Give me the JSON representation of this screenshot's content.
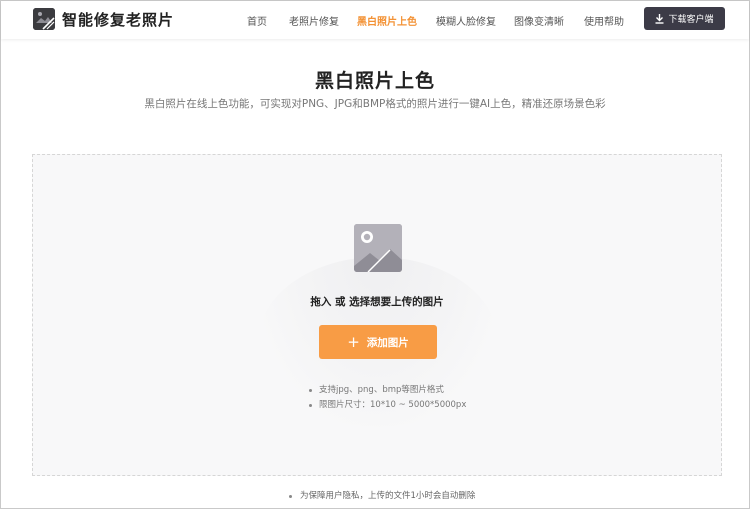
{
  "header": {
    "title": "智能修复老照片",
    "nav": [
      {
        "label": "首页",
        "active": false
      },
      {
        "label": "老照片修复",
        "active": false
      },
      {
        "label": "黑白照片上色",
        "active": true
      },
      {
        "label": "模糊人脸修复",
        "active": false
      },
      {
        "label": "图像变清晰",
        "active": false
      },
      {
        "label": "使用帮助",
        "active": false
      }
    ],
    "download_label": "下载客户端"
  },
  "main": {
    "title": "黑白照片上色",
    "subtitle": "黑白照片在线上色功能，可实现对PNG、JPG和BMP格式的照片进行一键AI上色，精准还原场景色彩"
  },
  "upload": {
    "prompt": "拖入 或 选择想要上传的图片",
    "add_label": "添加图片",
    "tips": [
      "支持jpg、png、bmp等图片格式",
      "限图片尺寸：10*10 ~ 5000*5000px"
    ]
  },
  "footer": {
    "privacy_note": "为保障用户隐私，上传的文件1小时会自动删除"
  },
  "colors": {
    "accent": "#f39235",
    "button": "#f89c45",
    "dark": "#3c3b47"
  }
}
